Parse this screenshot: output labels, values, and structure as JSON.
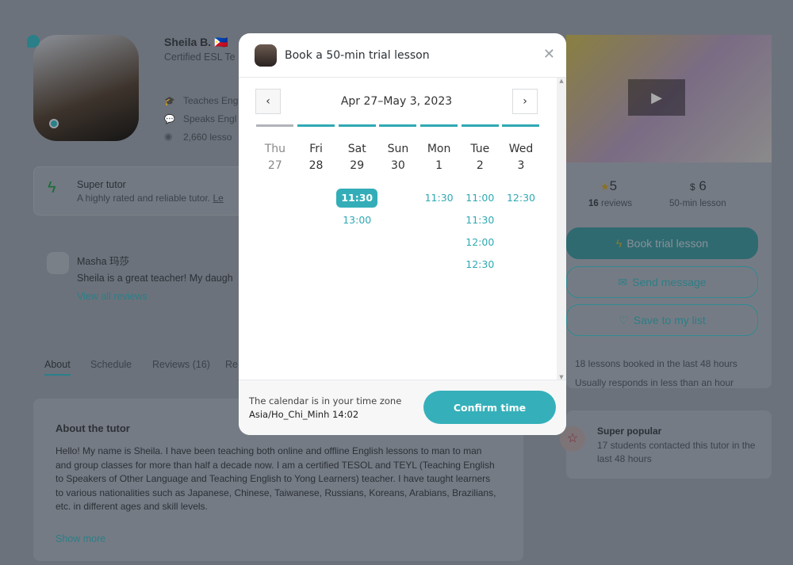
{
  "tutor": {
    "name": "Sheila B.",
    "flag": "🇵🇭",
    "headline": "Certified ESL Te",
    "teaches": "Teaches Eng",
    "speaks": "Speaks Engl",
    "lessons": "2,660 lesso"
  },
  "super_tutor": {
    "title": "Super tutor",
    "desc": "A highly rated and reliable tutor.",
    "link": "Le"
  },
  "review": {
    "author": "Masha 玛莎",
    "text": "Sheila is a great teacher! My daugh",
    "view_all": "View all reviews"
  },
  "tabs": [
    {
      "label": "About",
      "active": true
    },
    {
      "label": "Schedule"
    },
    {
      "label": "Reviews (16)"
    },
    {
      "label": "Re"
    }
  ],
  "about": {
    "title": "About the tutor",
    "text": "Hello! My name is Sheila. I have been teaching both online and offline English lessons to man to man and group classes for more than half a decade now. I am a certified TESOL and TEYL (Teaching English to Speakers of Other Language and Teaching English to Yong Learners) teacher. I have taught learners to various nationalities such as Japanese, Chinese, Taiwanese, Russians, Koreans, Arabians, Brazilians, etc. in different ages and skill levels.",
    "show_more": "Show more"
  },
  "stats": {
    "rating": "5",
    "reviews_count": "16",
    "reviews_label": "reviews",
    "currency": "$",
    "price": "6",
    "price_label": "50-min lesson"
  },
  "actions": {
    "book": "Book trial lesson",
    "message": "Send message",
    "save": "Save to my list"
  },
  "info": {
    "booked": "18 lessons booked in the last 48 hours",
    "responds": "Usually responds in less than an hour"
  },
  "popular": {
    "title": "Super popular",
    "desc": "17 students contacted this tutor in the last 48 hours"
  },
  "modal": {
    "title": "Book a 50-min trial lesson",
    "range": "Apr 27–May 3, 2023",
    "days": [
      {
        "name": "Thu",
        "date": "27",
        "available": false,
        "slots": []
      },
      {
        "name": "Fri",
        "date": "28",
        "available": true,
        "slots": []
      },
      {
        "name": "Sat",
        "date": "29",
        "available": true,
        "slots": [
          "11:30",
          "13:00"
        ],
        "selected": "11:30"
      },
      {
        "name": "Sun",
        "date": "30",
        "available": true,
        "slots": []
      },
      {
        "name": "Mon",
        "date": "1",
        "available": true,
        "slots": [
          "11:30"
        ]
      },
      {
        "name": "Tue",
        "date": "2",
        "available": true,
        "slots": [
          "11:00",
          "11:30",
          "12:00",
          "12:30"
        ]
      },
      {
        "name": "Wed",
        "date": "3",
        "available": true,
        "slots": [
          "12:30"
        ]
      }
    ],
    "tz_label": "The calendar is in your time zone",
    "tz_value": "Asia/Ho_Chi_Minh 14:02",
    "confirm": "Confirm time"
  },
  "colors": {
    "accent": "#35b0ba"
  }
}
